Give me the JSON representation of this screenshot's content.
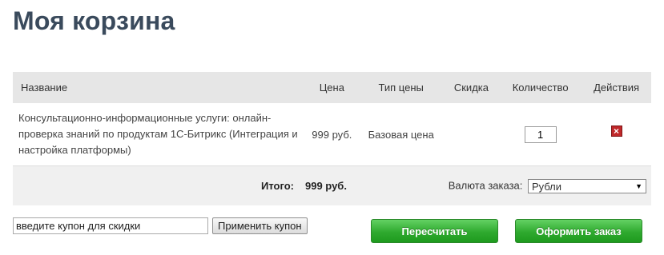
{
  "page": {
    "title": "Моя корзина"
  },
  "table": {
    "headers": {
      "name": "Название",
      "price": "Цена",
      "price_type": "Тип цены",
      "discount": "Скидка",
      "quantity": "Количество",
      "actions": "Действия"
    },
    "items": [
      {
        "name": "Консультационно-информационные услуги: онлайн-проверка знаний по продуктам 1С-Битрикс (Интеграция и настройка платформы)",
        "price": "999 руб.",
        "price_type": "Базовая цена",
        "discount": "",
        "quantity": "1",
        "delete_icon": "close-icon"
      }
    ],
    "total": {
      "label": "Итого:",
      "value": "999 руб."
    },
    "currency": {
      "label": "Валюта заказа:",
      "selected": "Рубли"
    }
  },
  "coupon": {
    "value": "введите купон для скидки",
    "apply_label": "Применить купон"
  },
  "actions": {
    "recalculate_label": "Пересчитать",
    "checkout_label": "Оформить заказ"
  },
  "colors": {
    "title": "#3a4a5c",
    "header_bg": "#e6e6e6",
    "total_bg": "#f0f0f0",
    "button_green": "#2faa2f",
    "delete_red": "#c0282a"
  }
}
